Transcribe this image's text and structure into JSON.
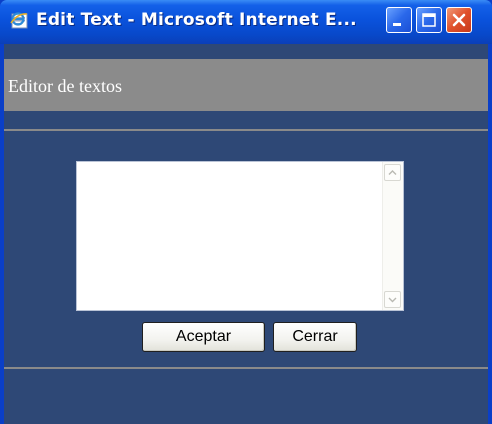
{
  "window": {
    "title": "Edit Text - Microsoft Internet E...",
    "icon": "internet-explorer-icon",
    "controls": [
      "minimize-icon",
      "maximize-icon",
      "close-icon"
    ]
  },
  "header": {
    "title": "Editor de textos"
  },
  "editor": {
    "value": "",
    "scrollbar": {
      "up_icon": "chevron-up-icon",
      "down_icon": "chevron-down-icon"
    }
  },
  "buttons": {
    "accept_label": "Aceptar",
    "close_label": "Cerrar"
  },
  "colors": {
    "titlebar": "#0a52dc",
    "client_background": "#2e4876",
    "header_band": "#8b8b8b",
    "close_button": "#e0512b"
  }
}
